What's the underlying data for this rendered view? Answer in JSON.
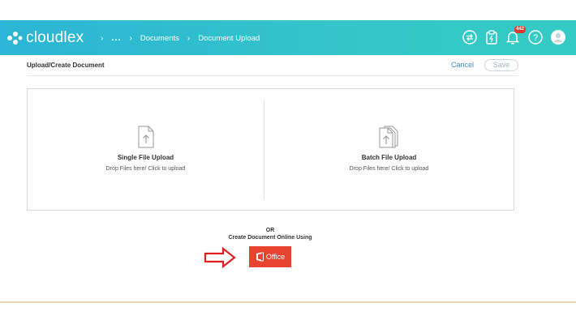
{
  "app": {
    "name": "cloudlex"
  },
  "breadcrumb": {
    "more": "...",
    "items": [
      "Documents",
      "Document Upload"
    ]
  },
  "nav": {
    "notification_count": "442",
    "icons": [
      "transfer-icon",
      "clipboard-icon",
      "bell-icon",
      "help-icon",
      "avatar-icon"
    ]
  },
  "page": {
    "title": "Upload/Create Document",
    "cancel_label": "Cancel",
    "save_label": "Save"
  },
  "upload": {
    "single": {
      "title": "Single File Upload",
      "subtitle": "Drop Files here/ Click to upload"
    },
    "batch": {
      "title": "Batch File Upload",
      "subtitle": "Drop Files here/ Click to upload"
    }
  },
  "create": {
    "or_label": "OR",
    "prompt": "Create Document Online Using",
    "office_label": "Office"
  },
  "colors": {
    "header": "#2bb5d6",
    "office": "#e8432e",
    "arrow": "#e02020",
    "link": "#3b8fd0"
  }
}
